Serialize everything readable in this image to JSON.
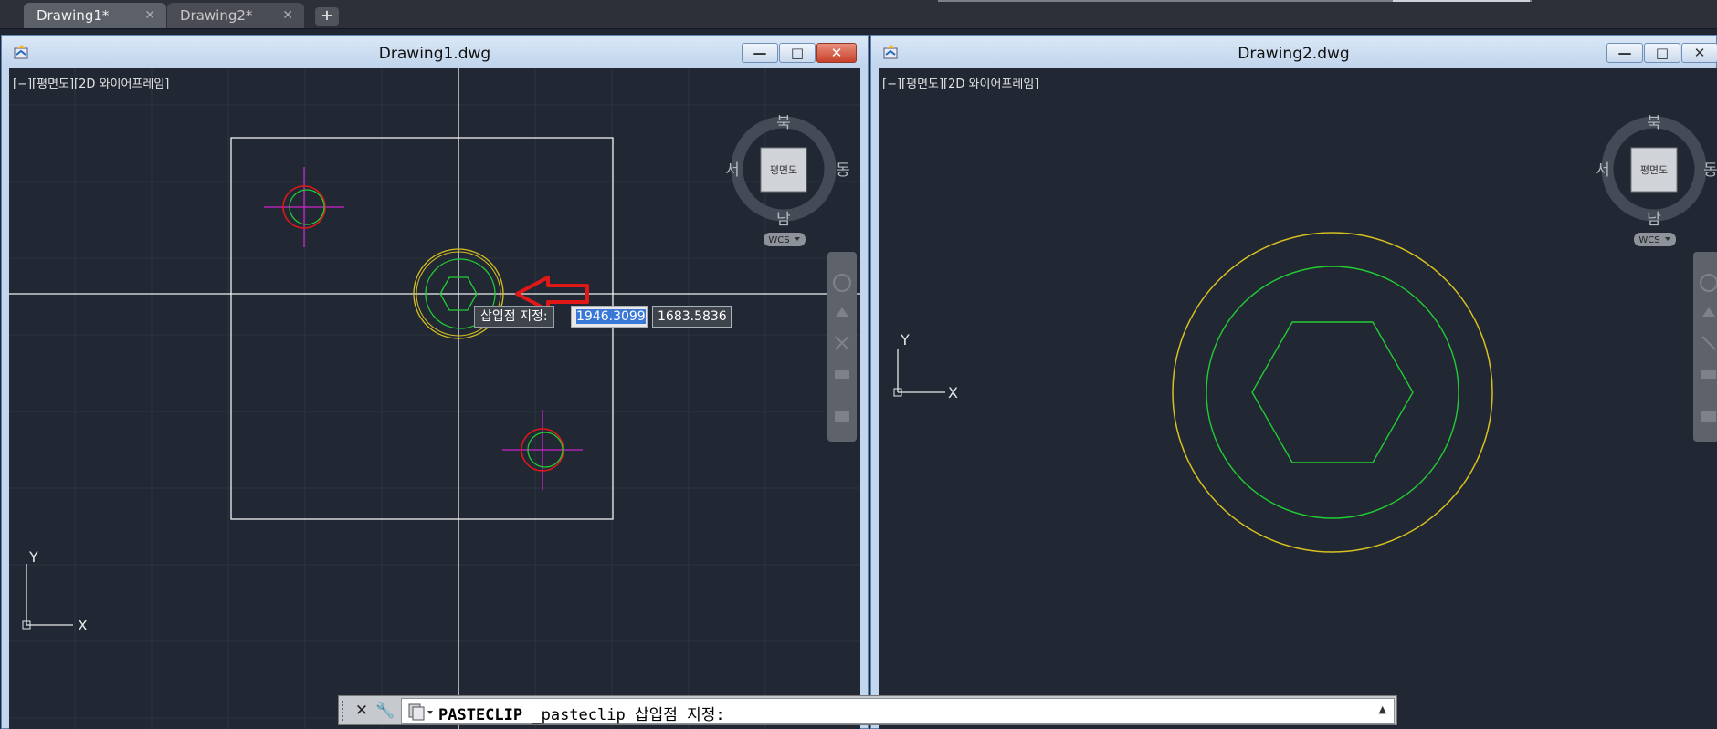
{
  "tabs": [
    {
      "label": "Drawing1*",
      "close": "✕"
    },
    {
      "label": "Drawing2*",
      "close": "✕"
    }
  ],
  "new_tab_label": "+",
  "windows": [
    {
      "title": "Drawing1.dwg",
      "viewport_label": "[−][평면도][2D 와이어프레임]",
      "viewcube": {
        "top": "평면도",
        "north": "북",
        "south": "남",
        "east": "동",
        "west": "서",
        "ucs": "WCS"
      }
    },
    {
      "title": "Drawing2.dwg",
      "viewport_label": "[−][평면도][2D 와이어프레임]",
      "viewcube": {
        "top": "평면도",
        "north": "북",
        "south": "남",
        "east": "동",
        "west": "서",
        "ucs": "WCS"
      }
    }
  ],
  "window_buttons": {
    "minimize": "—",
    "maximize": "□",
    "close": "✕"
  },
  "ucs_axis": {
    "x": "X",
    "y": "Y"
  },
  "insert_prompt": {
    "label": "삽입점 지정:",
    "x_value": "1946.3099",
    "y_value": "1683.5836"
  },
  "command_line": {
    "command": "PASTECLIP",
    "text": " _pasteclip 삽입점 지정:"
  },
  "colors": {
    "background": "#212833",
    "green": "#22cc33",
    "yellow": "#d8c020",
    "red": "#e01818",
    "magenta": "#cc22cc",
    "white": "#f0f0f0"
  }
}
